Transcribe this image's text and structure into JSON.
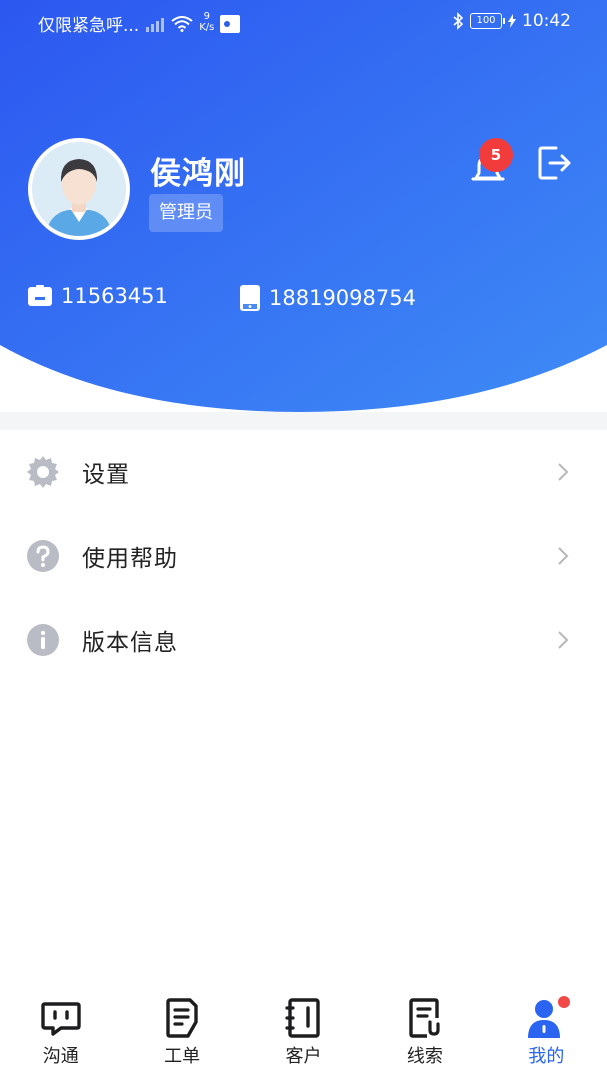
{
  "status_bar": {
    "carrier": "仅限紧急呼...",
    "net_speed_value": "9",
    "net_speed_unit": "K/s",
    "battery": "100",
    "time": "10:42"
  },
  "profile": {
    "name": "侯鸿刚",
    "role": "管理员",
    "notification_count": "5",
    "employee_id": "11563451",
    "phone": "18819098754"
  },
  "menu": {
    "items": [
      {
        "label": "设置",
        "icon": "gear-icon"
      },
      {
        "label": "使用帮助",
        "icon": "question-icon"
      },
      {
        "label": "版本信息",
        "icon": "info-icon"
      }
    ]
  },
  "tabbar": {
    "tabs": [
      {
        "label": "沟通",
        "icon": "chat-icon"
      },
      {
        "label": "工单",
        "icon": "ticket-icon"
      },
      {
        "label": "客户",
        "icon": "customer-book-icon"
      },
      {
        "label": "线索",
        "icon": "lead-doc-icon"
      },
      {
        "label": "我的",
        "icon": "profile-icon"
      }
    ],
    "active_index": 4
  },
  "colors": {
    "header_gradient_start": "#2c57f0",
    "header_gradient_end": "#3f8cf6",
    "active_tab": "#2a64f0",
    "badge": "#f23b3b",
    "menu_icon": "#b9bcc4"
  }
}
